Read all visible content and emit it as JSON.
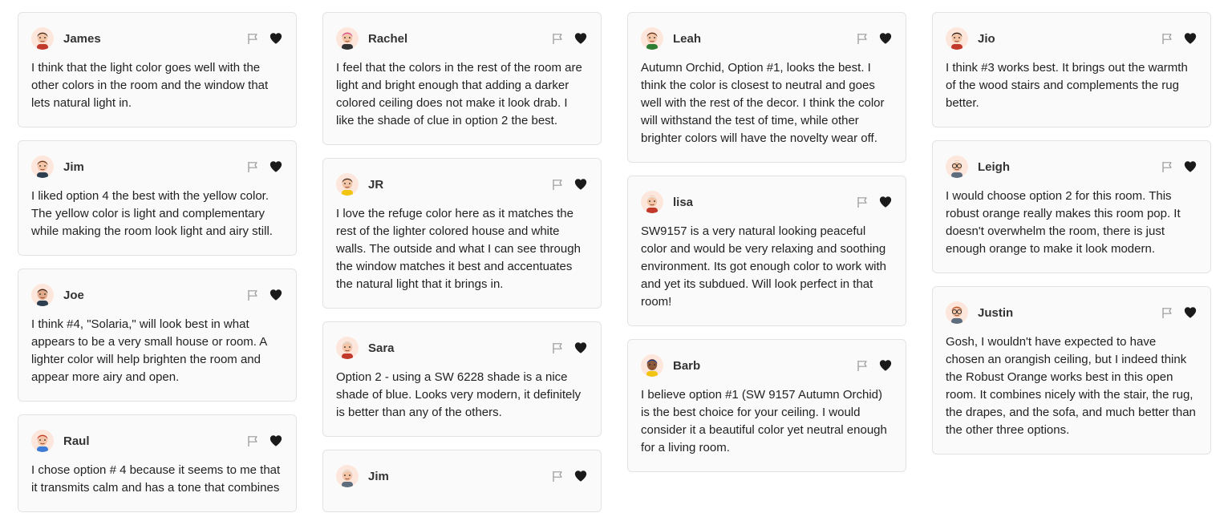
{
  "colors": {
    "accent": "#1a1a1a",
    "card_bg": "#fafafa",
    "border": "#e3e3e3"
  },
  "columns": [
    [
      {
        "name": "James",
        "avatar": "male-dark-hair",
        "text": "I think that the light color goes well with the other colors in the room and the window that lets natural light in."
      },
      {
        "name": "Jim",
        "avatar": "male-brown-hair",
        "text": "I liked option 4 the best with the yellow color. The yellow color is light and complementary while making the room look light and airy still."
      },
      {
        "name": "Joe",
        "avatar": "male-beard",
        "text": "I think #4, \"Solaria,\" will look best in what appears to be a very small house or room. A lighter color will help brighten the room and appear more airy and open."
      },
      {
        "name": "Raul",
        "avatar": "male-red-hair",
        "text": "I chose option # 4 because it seems to me that it transmits calm and has a tone that combines"
      }
    ],
    [
      {
        "name": "Rachel",
        "avatar": "female-pink-hair",
        "text": "I feel that the colors in the rest of the room are light and bright enough that adding a darker colored ceiling does not make it look drab. I like the shade of clue in option 2 the best."
      },
      {
        "name": "JR",
        "avatar": "male-yellow-shirt",
        "text": "I love the refuge color here as it matches the rest of the lighter colored house and white walls. The outside and what I can see through the window matches it best and accentuates the natural light that it brings in."
      },
      {
        "name": "Sara",
        "avatar": "female-gray-hair",
        "text": "Option 2 - using a SW 6228 shade is a nice shade of blue. Looks very modern, it definitely is better than any of the others."
      },
      {
        "name": "Jim",
        "avatar": "male-gray-hair",
        "text": ""
      }
    ],
    [
      {
        "name": "Leah",
        "avatar": "female-bun",
        "text": "Autumn Orchid, Option #1, looks the best. I think the color is closest to neutral and goes well with the rest of the decor. I think the color will withstand the test of time, while other brighter colors will have the novelty wear off."
      },
      {
        "name": "lisa",
        "avatar": "female-white-hair",
        "text": "SW9157 is a very natural looking peaceful color and would be very relaxing and soothing environment. Its got enough color to work with and yet its subdued. Will look perfect in that room!"
      },
      {
        "name": "Barb",
        "avatar": "female-blue-headscarf",
        "text": "I believe option #1 (SW 9157 Autumn Orchid) is the best choice for your ceiling. I would consider it a beautiful color yet neutral enough for a living room."
      }
    ],
    [
      {
        "name": "Jio",
        "avatar": "female-black-hair",
        "text": "I think #3 works best. It brings out the warmth of the wood stairs and complements the rug better."
      },
      {
        "name": "Leigh",
        "avatar": "male-glasses-white-hair",
        "text": "I would choose option 2 for this room. This robust orange really makes this room pop. It doesn't overwhelm the room, there is just enough orange to make it look modern."
      },
      {
        "name": "Justin",
        "avatar": "male-glasses-ginger",
        "text": "Gosh, I wouldn't have expected to have chosen an orangish ceiling, but I indeed think the Robust Orange works best in this open room. It combines nicely with the stair, the rug, the drapes, and the sofa, and much better than the other three options."
      }
    ]
  ]
}
